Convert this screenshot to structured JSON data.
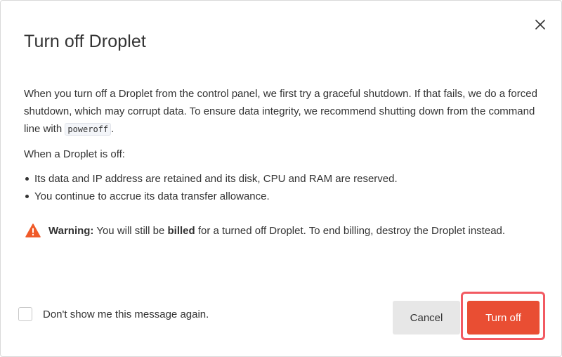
{
  "dialog": {
    "title": "Turn off Droplet",
    "close_icon": "close-icon",
    "intro_before_code": "When you turn off a Droplet from the control panel, we first try a graceful shutdown. If that fails, we do a forced shutdown, which may corrupt data. To ensure data integrity, we recommend shutting down from the command line with ",
    "intro_code": "poweroff",
    "intro_after_code": ".",
    "off_heading": "When a Droplet is off:",
    "bullets": [
      "Its data and IP address are retained and its disk, CPU and RAM are reserved.",
      "You continue to accrue its data transfer allowance."
    ],
    "warning": {
      "icon": "warning-triangle-icon",
      "label": "Warning:",
      "text_before": " You will still be ",
      "bold_word": "billed",
      "text_after": " for a turned off Droplet. To end billing, destroy the Droplet instead."
    },
    "checkbox_label": "Don't show me this message again.",
    "checkbox_checked": false,
    "cancel_label": "Cancel",
    "turn_off_label": "Turn off",
    "colors": {
      "primary_button": "#e94e33",
      "warning_icon": "#f05a28",
      "highlight": "#f25a62"
    }
  }
}
